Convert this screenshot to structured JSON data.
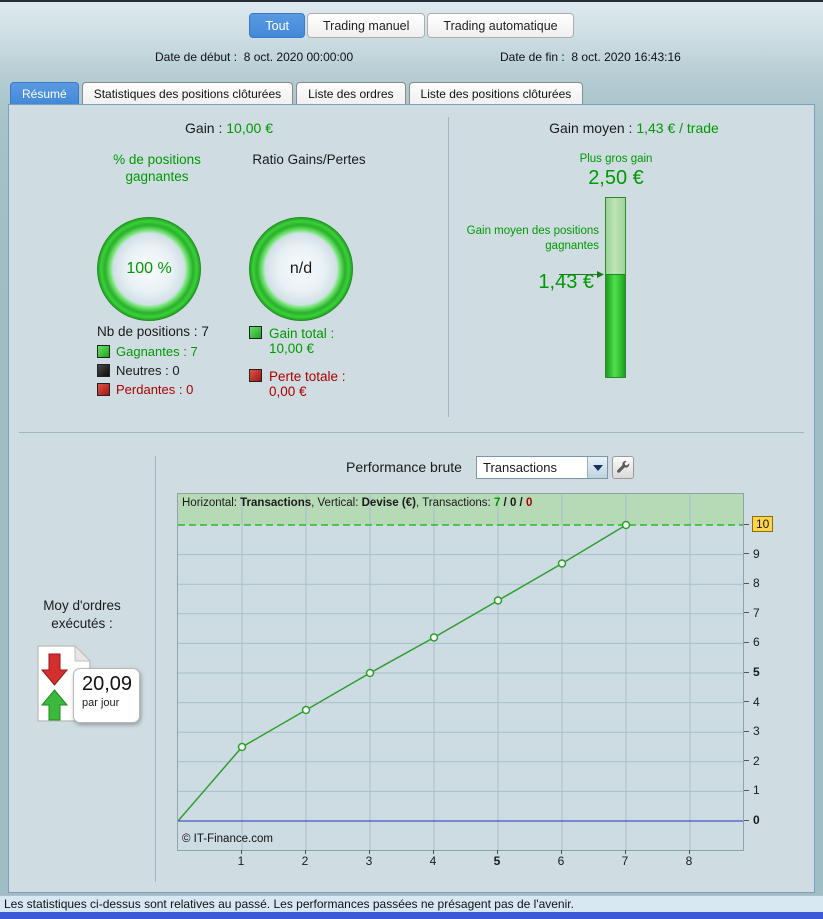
{
  "header": {
    "buttons": [
      {
        "label": "Tout"
      },
      {
        "label": "Trading manuel"
      },
      {
        "label": "Trading automatique"
      }
    ],
    "date_start_label": "Date de début :",
    "date_start_value": "8 oct. 2020 00:00:00",
    "date_end_label": "Date de fin :",
    "date_end_value": "8 oct. 2020 16:43:16"
  },
  "tabs": [
    {
      "label": "Résumé"
    },
    {
      "label": "Statistiques des positions clôturées"
    },
    {
      "label": "Liste des ordres"
    },
    {
      "label": "Liste des positions clôturées"
    }
  ],
  "summary": {
    "gain_label": "Gain :",
    "gain_value": "10,00 €",
    "pct_title": "% de positions gagnantes",
    "pct_value": "100 %",
    "ratio_title": "Ratio Gains/Pertes",
    "ratio_value": "n/d",
    "nb_label": "Nb de positions :",
    "nb_value": "7",
    "legend": [
      {
        "label": "Gagnantes :",
        "value": "7",
        "color": "#009900"
      },
      {
        "label": "Neutres :",
        "value": "0",
        "color": "#1a1a1a"
      },
      {
        "label": "Perdantes :",
        "value": "0",
        "color": "#aa0000"
      }
    ],
    "totals": [
      {
        "label": "Gain total :",
        "value": "10,00 €",
        "color": "#009900"
      },
      {
        "label": "Perte totale :",
        "value": "0,00 €",
        "color": "#aa0000"
      }
    ]
  },
  "gain_moyen": {
    "title_label": "Gain moyen :",
    "title_value": "1,43 € / trade",
    "max_label": "Plus gros gain",
    "max_value": "2,50 €",
    "max_num": 2.5,
    "avg_label": "Gain moyen des positions gagnantes",
    "avg_value": "1,43 €",
    "avg_num": 1.43
  },
  "orders": {
    "title_line1": "Moy d'ordres",
    "title_line2": "exécutés :",
    "value": "20,09",
    "unit": "par jour"
  },
  "performance": {
    "label": "Performance brute",
    "dropdown_value": "Transactions"
  },
  "chart_data": {
    "type": "line",
    "title": "Performance brute",
    "info": {
      "h_label": "Horizontal: ",
      "h_value": "Transactions",
      "v_label": ", Vertical: ",
      "v_value": "Devise (€)",
      "t_label": ", Transactions: ",
      "wins": "7",
      "sep": " / ",
      "neutral": "0",
      "losses": "0"
    },
    "x": [
      0,
      1,
      2,
      3,
      4,
      5,
      6,
      7
    ],
    "y": [
      0,
      2.5,
      3.75,
      5.0,
      6.2,
      7.45,
      8.7,
      10.0
    ],
    "xlabel": "Transactions",
    "ylabel": "Devise (€)",
    "xticks": [
      1,
      2,
      3,
      4,
      5,
      6,
      7,
      8
    ],
    "yticks": [
      0,
      1,
      2,
      3,
      4,
      5,
      6,
      7,
      8,
      9,
      10
    ],
    "x_bold": [
      5
    ],
    "y_bold": [
      0,
      5
    ],
    "y_highlight": 10,
    "xlim": [
      0,
      8.8
    ],
    "ylim": [
      0,
      10
    ],
    "threshold": 10,
    "zero_line": 0,
    "grid": true,
    "legend_position": "none",
    "copyright": "© IT-Finance.com",
    "colors": {
      "line": "#2f9e2f",
      "marker_fill": "#f2f8f4",
      "band": "#b6dab6",
      "threshold": "#2db82d",
      "zero": "#2233bb",
      "grid": "#a9bfc9",
      "highlight_bg": "#ffd34d",
      "wins": "#009900",
      "losses": "#aa0000"
    }
  },
  "footer": {
    "disclaimer": "Les statistiques ci-dessus sont relatives au passé. Les performances passées ne présagent pas de l'avenir."
  },
  "colors": {
    "accent": "#4a90dd",
    "green": "#009900",
    "red": "#aa0000"
  }
}
